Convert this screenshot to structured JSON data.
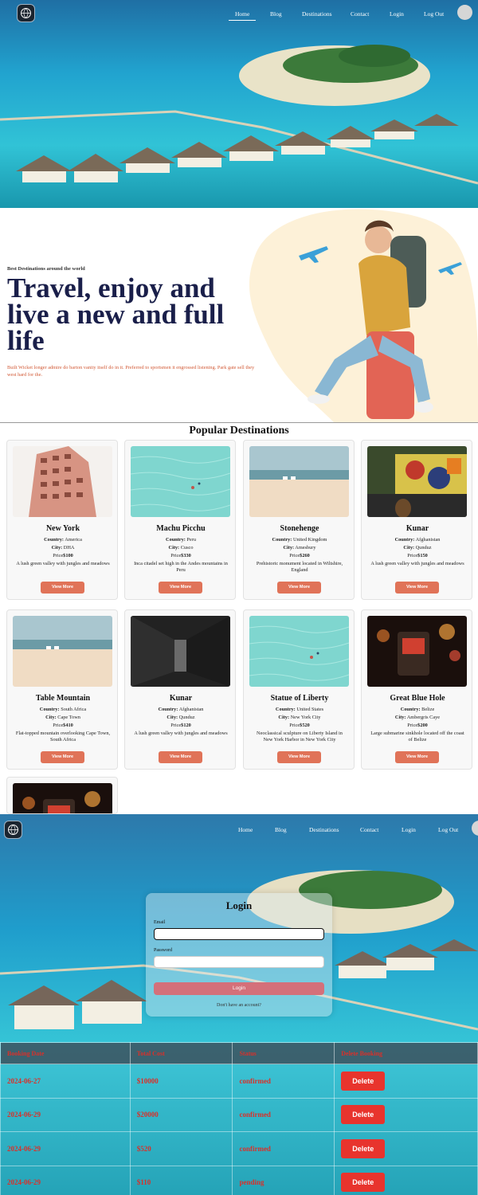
{
  "nav": {
    "items": [
      {
        "label": "Home",
        "active": true
      },
      {
        "label": "Blog"
      },
      {
        "label": "Destinations"
      },
      {
        "label": "Contact"
      },
      {
        "label": "Login"
      },
      {
        "label": "Log Out"
      }
    ],
    "logo_icon": "globe-logo-icon",
    "avatar_icon": "user-avatar-icon"
  },
  "intro": {
    "tagline": "Best Destinations around the world",
    "headline": "Travel, enjoy and live a new and full life",
    "description": "Built Wicket longer admire do barton vanity itself do in it. Preferred to sportsmen it engrossed listening. Park gate sell they west hard for the."
  },
  "destinations": {
    "title": "Popular Destinations",
    "country_label": "Country:",
    "city_label": "City:",
    "price_label": "Price",
    "button_label": "View More",
    "cards": [
      {
        "name": "New York",
        "country": "America",
        "city": "DHA",
        "price": "$100",
        "description": "A lush green valley with jungles and meadows",
        "image": "building"
      },
      {
        "name": "Machu Picchu",
        "country": "Peru",
        "city": "Cusco",
        "price": "$330",
        "description": "Inca citadel set high in the Andes mountains in Peru",
        "image": "water"
      },
      {
        "name": "Stonehenge",
        "country": "United Kingdom",
        "city": "Amesbury",
        "price": "$260",
        "description": "Prehistoric monument located in Wiltshire, England",
        "image": "beach"
      },
      {
        "name": "Kunar",
        "country": "Afghanistan",
        "city": "Qunduz",
        "price": "$150",
        "description": "A lush green valley with jungles and meadows",
        "image": "graffiti"
      },
      {
        "name": "Table Mountain",
        "country": "South Africa",
        "city": "Cape Town",
        "price": "$410",
        "description": "Flat-topped mountain overlooking Cape Town, South Africa",
        "image": "beach"
      },
      {
        "name": "Kunar",
        "country": "Afghanistan",
        "city": "Qunduz",
        "price": "$120",
        "description": "A lush green valley with jungles and meadows",
        "image": "corridor"
      },
      {
        "name": "Statue of Liberty",
        "country": "United States",
        "city": "New York City",
        "price": "$520",
        "description": "Neoclassical sculpture on Liberty Island in New York Harbor in New York City",
        "image": "water"
      },
      {
        "name": "Great Blue Hole",
        "country": "Belize",
        "city": "Ambergris Caye",
        "price": "$200",
        "description": "Large submarine sinkhole located off the coast of Belize",
        "image": "night"
      },
      {
        "name": "",
        "image": "night"
      }
    ]
  },
  "login": {
    "title": "Login",
    "email_label": "Email",
    "email_value": "",
    "password_label": "Password",
    "password_value": "",
    "button_label": "Login",
    "signup_text": "Don't have an account?"
  },
  "bookings": {
    "headers": [
      "Booking Date",
      "Total Cost",
      "Status",
      "Delete Booking"
    ],
    "rows": [
      {
        "date": "2024-06-27",
        "cost": "$10000",
        "status": "confirmed",
        "action": "Delete"
      },
      {
        "date": "2024-06-29",
        "cost": "$20000",
        "status": "confirmed",
        "action": "Delete"
      },
      {
        "date": "2024-06-29",
        "cost": "$520",
        "status": "confirmed",
        "action": "Delete"
      },
      {
        "date": "2024-06-29",
        "cost": "$110",
        "status": "pending",
        "action": "Delete"
      }
    ]
  },
  "colors": {
    "accent": "#e07358",
    "headline": "#1a1f4a",
    "description": "#d25a36",
    "delete": "#e8342d",
    "table_text": "#d9302a"
  }
}
